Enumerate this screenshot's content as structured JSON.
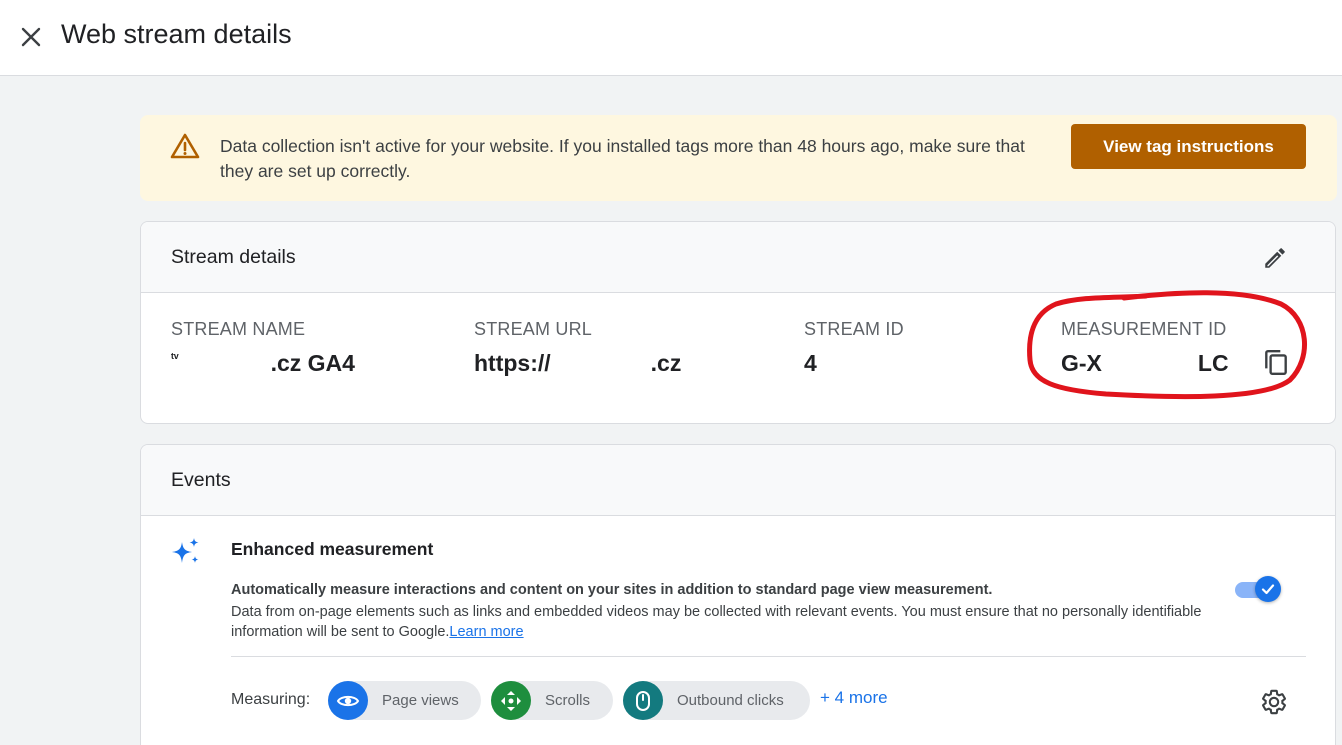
{
  "header": {
    "title": "Web stream details",
    "close_icon": "close-icon"
  },
  "alert": {
    "icon": "warning-icon",
    "message": "Data collection isn't active for your website. If you installed tags more than 48 hours ago, make sure that they are set up correctly.",
    "button_label": "View tag instructions",
    "background": "#fef7e0",
    "button_color": "#b06000"
  },
  "stream_details": {
    "title": "Stream details",
    "edit_icon": "pencil-icon",
    "fields": {
      "name": {
        "label": "STREAM NAME",
        "value_start": "ᵗᵛ",
        "value_end": ".cz GA4"
      },
      "url": {
        "label": "STREAM URL",
        "value_start": "https://",
        "value_end": ".cz"
      },
      "id": {
        "label": "STREAM ID",
        "value_start": "4"
      },
      "measurement": {
        "label": "MEASUREMENT ID",
        "value_start": "G-X",
        "value_end": "LC"
      }
    },
    "copy_icon": "copy-icon",
    "annotation_color": "#e0141c"
  },
  "events": {
    "title": "Events",
    "enhanced": {
      "icon": "sparkle-icon",
      "title": "Enhanced measurement",
      "desc_bold": "Automatically measure interactions and content on your sites in addition to standard page view measurement.",
      "desc": "Data from on-page elements such as links and embedded videos may be collected with relevant events. You must ensure that no personally identifiable information will be sent to Google.",
      "link": "Learn more",
      "toggle_on": true
    },
    "measuring_label": "Measuring:",
    "chips": [
      {
        "label": "Page views",
        "icon": "eye-icon",
        "color": "#1a73e8"
      },
      {
        "label": "Scrolls",
        "icon": "scroll-crosshair-icon",
        "color": "#1e8e3e"
      },
      {
        "label": "Outbound clicks",
        "icon": "mouse-icon",
        "color": "#137a7f"
      }
    ],
    "more": "+ 4 more",
    "settings_icon": "gear-icon"
  }
}
